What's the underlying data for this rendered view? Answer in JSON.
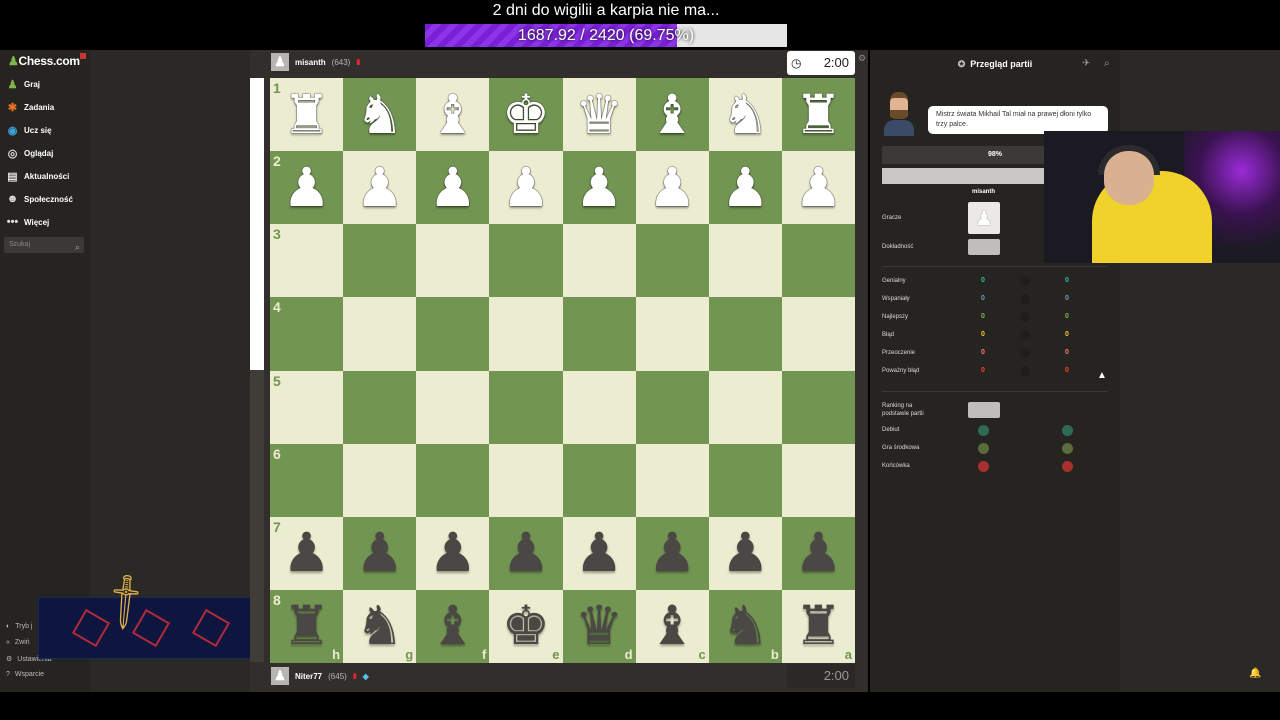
{
  "stream": {
    "title": "2 dni do wigilii a karpia nie ma...",
    "goal_text": "1687.92 / 2420 (69.75%)",
    "goal_fraction": 0.6975
  },
  "sidebar": {
    "logo": "Chess.com",
    "items": [
      {
        "label": "Graj",
        "icon": "play-icon"
      },
      {
        "label": "Zadania",
        "icon": "puzzle-icon"
      },
      {
        "label": "Ucz się",
        "icon": "learn-icon"
      },
      {
        "label": "Oglądaj",
        "icon": "watch-icon"
      },
      {
        "label": "Aktualności",
        "icon": "news-icon"
      },
      {
        "label": "Społeczność",
        "icon": "community-icon"
      },
      {
        "label": "Więcej",
        "icon": "more-icon"
      }
    ],
    "search_placeholder": "Szukaj",
    "bottom_items": [
      {
        "label": "Tryb j",
        "icon": "theme-icon"
      },
      {
        "label": "Zwiń",
        "icon": "collapse-icon"
      },
      {
        "label": "Ustawienia",
        "icon": "settings-icon"
      },
      {
        "label": "Wsparcie",
        "icon": "help-icon"
      }
    ]
  },
  "game": {
    "top_player": {
      "name": "misanth",
      "rating": "(643)"
    },
    "bottom_player": {
      "name": "Niter77",
      "rating": "(645)"
    },
    "top_clock": "2:00",
    "bottom_clock": "2:00",
    "eval_white_fraction": 0.5,
    "rank_labels": [
      "1",
      "2",
      "3",
      "4",
      "5",
      "6",
      "7",
      "8"
    ],
    "file_labels": [
      "h",
      "g",
      "f",
      "e",
      "d",
      "c",
      "b",
      "a"
    ],
    "rows": [
      [
        "♜",
        "♞",
        "♝",
        "♚",
        "♛",
        "♝",
        "♞",
        "♜"
      ],
      [
        "♟",
        "♟",
        "♟",
        "♟",
        "♟",
        "♟",
        "♟",
        "♟"
      ],
      [
        "",
        "",
        "",
        "",
        "",
        "",
        "",
        ""
      ],
      [
        "",
        "",
        "",
        "",
        "",
        "",
        "",
        ""
      ],
      [
        "",
        "",
        "",
        "",
        "",
        "",
        "",
        ""
      ],
      [
        "",
        "",
        "",
        "",
        "",
        "",
        "",
        ""
      ],
      [
        "♟",
        "♟",
        "♟",
        "♟",
        "♟",
        "♟",
        "♟",
        "♟"
      ],
      [
        "♜",
        "♞",
        "♝",
        "♚",
        "♛",
        "♝",
        "♞",
        "♜"
      ]
    ],
    "row_colors": [
      "w",
      "w",
      "",
      "",
      "",
      "",
      "b",
      "b"
    ]
  },
  "review": {
    "title": "Przegląd partii",
    "coach_message": "Mistrz świata Mikhail Tal miał na prawej dłoni tylko trzy palce.",
    "accuracy_label": "98%",
    "player_column": "misanth",
    "players_label": "Gracze",
    "accuracy_row_label": "Dokładność",
    "stats": [
      {
        "label": "Genialny",
        "white": "0",
        "black": "0",
        "color": "#26c2a3"
      },
      {
        "label": "Wspaniały",
        "white": "0",
        "black": "0",
        "color": "#749bbf"
      },
      {
        "label": "Najlepszy",
        "white": "0",
        "black": "0",
        "color": "#81b64c"
      },
      {
        "label": "Błąd",
        "white": "0",
        "black": "0",
        "color": "#f7c631"
      },
      {
        "label": "Przeoczenie",
        "white": "0",
        "black": "0",
        "color": "#ff7769"
      },
      {
        "label": "Poważny błąd",
        "white": "0",
        "black": "0",
        "color": "#fa412d"
      }
    ],
    "rating_label_1": "Ranking na",
    "rating_label_2": "podstawie partii",
    "phases": [
      {
        "label": "Debiut",
        "color": "#2e6b57"
      },
      {
        "label": "Gra środkowa",
        "color": "#5c6b3e"
      },
      {
        "label": "Końcówka",
        "color": "#a8302d"
      }
    ]
  }
}
